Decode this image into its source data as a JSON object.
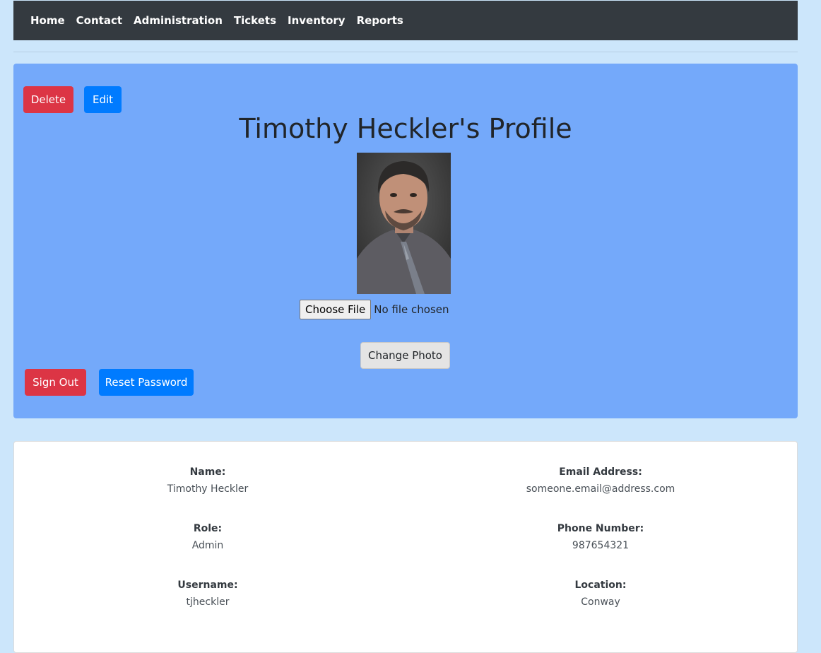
{
  "nav": {
    "items": [
      {
        "label": "Home"
      },
      {
        "label": "Contact"
      },
      {
        "label": "Administration"
      },
      {
        "label": "Tickets"
      },
      {
        "label": "Inventory"
      },
      {
        "label": "Reports"
      }
    ]
  },
  "profile": {
    "title": "Timothy Heckler's Profile",
    "delete_label": "Delete",
    "edit_label": "Edit",
    "photo_icon": "person-portrait-photo",
    "file_button_label": "Choose File",
    "file_status": "No file chosen",
    "change_photo_label": "Change Photo",
    "sign_out_label": "Sign Out",
    "reset_password_label": "Reset Password"
  },
  "details": {
    "name": {
      "label": "Name:",
      "value": "Timothy Heckler"
    },
    "email": {
      "label": "Email Address:",
      "value": "someone.email@address.com"
    },
    "role": {
      "label": "Role:",
      "value": "Admin"
    },
    "phone": {
      "label": "Phone Number:",
      "value": "987654321"
    },
    "username": {
      "label": "Username:",
      "value": "tjheckler"
    },
    "location": {
      "label": "Location:",
      "value": "Conway"
    }
  },
  "colors": {
    "page_background": "#cce6fb",
    "navbar": "#343a40",
    "panel": "#74a9fa",
    "danger": "#dc3545",
    "primary": "#007bff"
  }
}
